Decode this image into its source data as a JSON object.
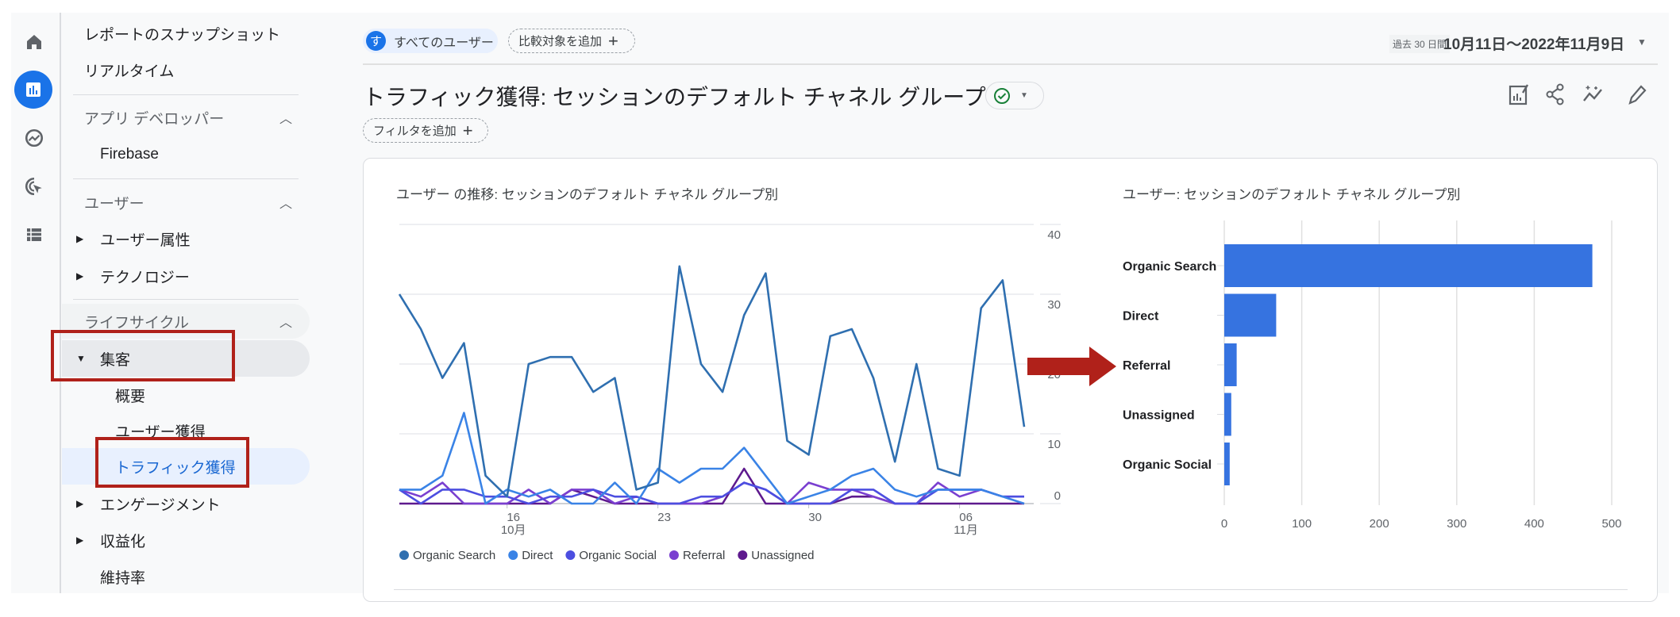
{
  "rail": {
    "icons": [
      "home-icon",
      "reports-icon",
      "explore-icon",
      "advertising-icon",
      "configure-icon"
    ],
    "accent": "#1a73e8"
  },
  "nav": {
    "snapshot": "レポートのスナップショット",
    "realtime": "リアルタイム",
    "app_dev": "アプリ デベロッパー",
    "firebase": "Firebase",
    "user": "ユーザー",
    "user_attr": "ユーザー属性",
    "tech": "テクノロジー",
    "lifecycle": "ライフサイクル",
    "acquisition": "集客",
    "overview": "概要",
    "user_acq": "ユーザー獲得",
    "traffic_acq": "トラフィック獲得",
    "engagement": "エンゲージメント",
    "monetization": "収益化",
    "retention": "維持率"
  },
  "topbar": {
    "segment_avatar": "す",
    "segment": "すべてのユーザー",
    "compare": "比較対象を追加",
    "date_preset": "過去 30 日間",
    "date_range": "10月11日～2022年11月9日"
  },
  "header": {
    "title": "トラフィック獲得: セッションのデフォルト チャネル グループ",
    "filter": "フィルタを追加"
  },
  "highlight_color": "#b0211a",
  "chart_data": [
    {
      "type": "line",
      "title": "ユーザー の推移: セッションのデフォルト チャネル グループ別",
      "x": [
        "10/11",
        "10/12",
        "10/13",
        "10/14",
        "10/15",
        "10/16",
        "10/17",
        "10/18",
        "10/19",
        "10/20",
        "10/21",
        "10/22",
        "10/23",
        "10/24",
        "10/25",
        "10/26",
        "10/27",
        "10/28",
        "10/29",
        "10/30",
        "10/31",
        "11/01",
        "11/02",
        "11/03",
        "11/04",
        "11/05",
        "11/06",
        "11/07",
        "11/08",
        "11/09"
      ],
      "xticks": [
        {
          "label": "16",
          "sub": "10月",
          "index": 5
        },
        {
          "label": "23",
          "sub": "",
          "index": 12
        },
        {
          "label": "30",
          "sub": "",
          "index": 19
        },
        {
          "label": "06",
          "sub": "11月",
          "index": 26
        }
      ],
      "ylim": [
        0,
        40
      ],
      "yticks": [
        "0",
        "10",
        "20",
        "30",
        "40"
      ],
      "grid": true,
      "legend": "bottom",
      "series": [
        {
          "name": "Organic Search",
          "color": "#2f6fb0",
          "values": [
            30,
            25,
            18,
            23,
            4,
            1,
            20,
            21,
            21,
            16,
            18,
            2,
            3,
            34,
            20,
            16,
            27,
            33,
            9,
            7,
            24,
            25,
            18,
            6,
            20,
            5,
            4,
            28,
            32,
            11
          ]
        },
        {
          "name": "Direct",
          "color": "#3a83e6",
          "values": [
            2,
            2,
            4,
            13,
            0,
            2,
            1,
            2,
            0,
            0,
            3,
            0,
            5,
            3,
            5,
            5,
            8,
            4,
            0,
            1,
            2,
            4,
            5,
            2,
            1,
            2,
            2,
            2,
            1,
            0
          ]
        },
        {
          "name": "Organic Social",
          "color": "#4c4ee0",
          "values": [
            2,
            0,
            2,
            2,
            1,
            1,
            0,
            1,
            1,
            2,
            1,
            1,
            0,
            0,
            1,
            1,
            3,
            2,
            0,
            0,
            0,
            2,
            2,
            0,
            0,
            2,
            2,
            2,
            1,
            1
          ]
        },
        {
          "name": "Referral",
          "color": "#7a3fd0",
          "values": [
            2,
            1,
            3,
            0,
            0,
            0,
            2,
            0,
            2,
            2,
            0,
            1,
            0,
            0,
            0,
            1,
            3,
            2,
            0,
            3,
            2,
            2,
            1,
            0,
            0,
            3,
            1,
            2,
            1,
            1
          ]
        },
        {
          "name": "Unassigned",
          "color": "#5e1a8e",
          "values": [
            0,
            0,
            0,
            0,
            0,
            0,
            0,
            0,
            2,
            1,
            0,
            0,
            0,
            0,
            0,
            0,
            5,
            0,
            0,
            0,
            0,
            1,
            1,
            0,
            0,
            0,
            0,
            0,
            0,
            0
          ]
        }
      ]
    },
    {
      "type": "bar",
      "orientation": "horizontal",
      "title": "ユーザー: セッションのデフォルト チャネル グループ別",
      "categories": [
        "Organic Search",
        "Direct",
        "Referral",
        "Unassigned",
        "Organic Social"
      ],
      "values": [
        475,
        67,
        16,
        9,
        7
      ],
      "xlim": [
        0,
        500
      ],
      "xticks": [
        "0",
        "100",
        "200",
        "300",
        "400",
        "500"
      ],
      "grid": true,
      "color": "#3673e0"
    }
  ]
}
